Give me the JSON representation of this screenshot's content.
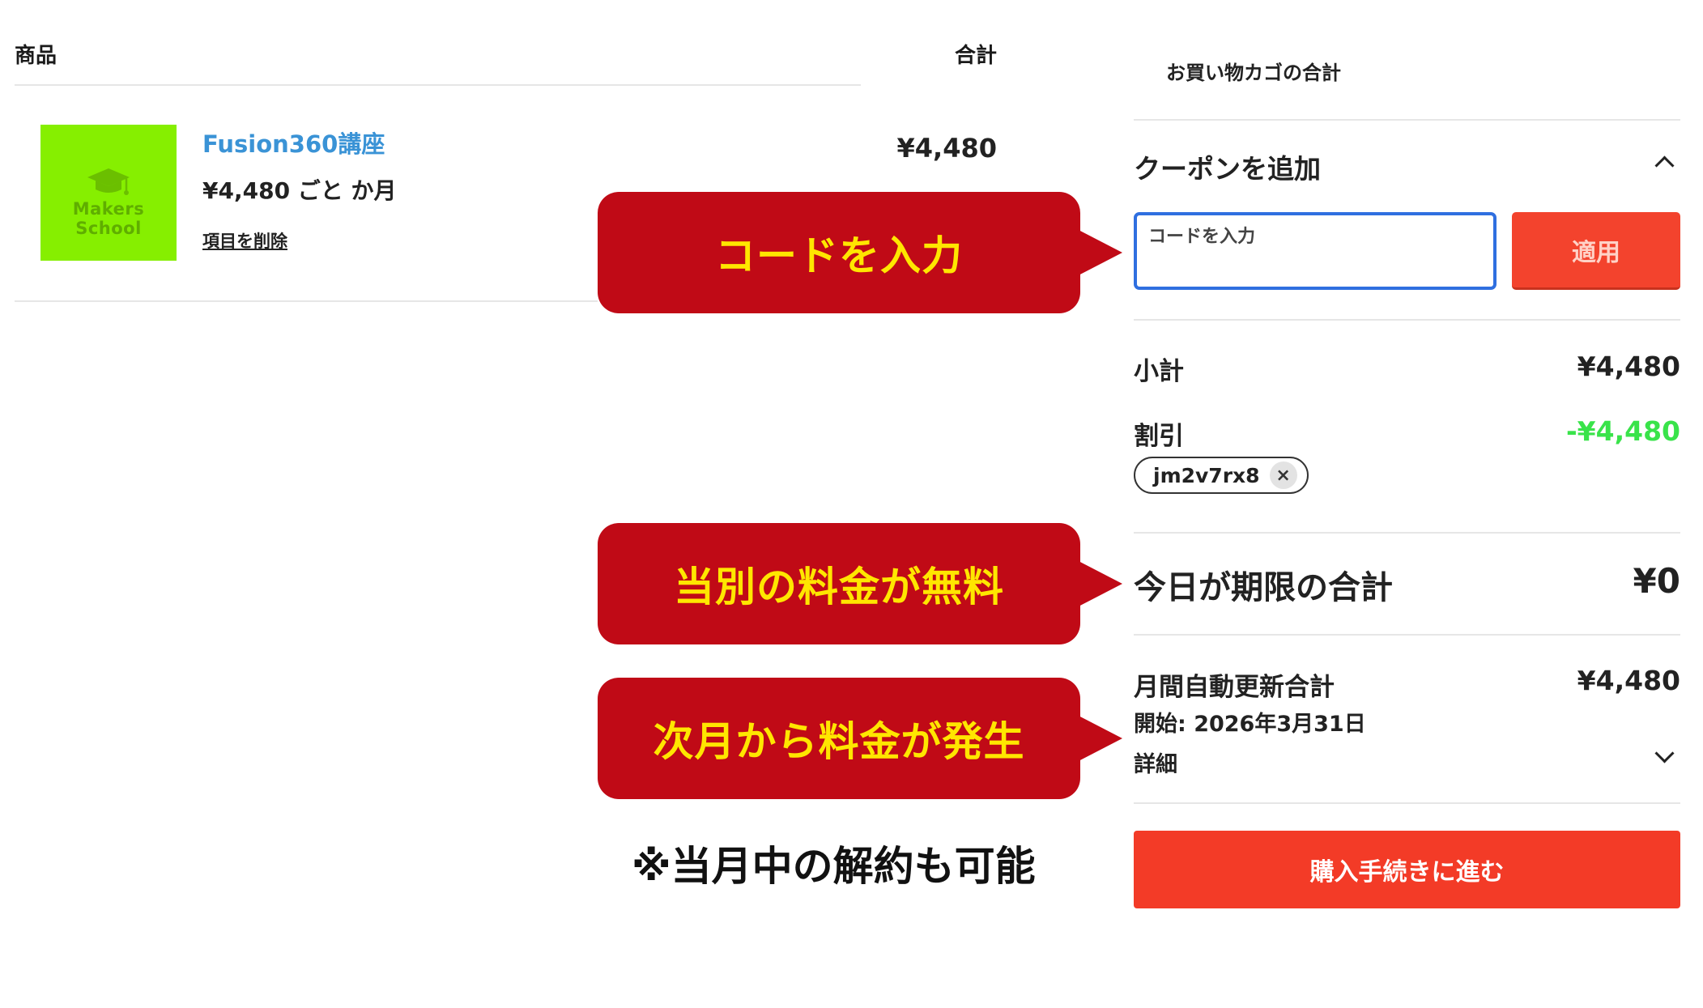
{
  "cart": {
    "columns": {
      "product": "商品",
      "total": "合計"
    },
    "item": {
      "brand": "Makers School",
      "title": "Fusion360講座",
      "price_text": "¥4,480 ごと か月",
      "remove_label": "項目を削除",
      "line_total": "¥4,480"
    }
  },
  "callouts": {
    "code": "コードを入力",
    "free_this_month": "当別の料金が無料",
    "next_month": "次月から料金が発生",
    "note": "※当月中の解約も可能"
  },
  "summary": {
    "title": "お買い物カゴの合計",
    "coupon": {
      "header": "クーポンを追加",
      "placeholder": "コードを入力",
      "apply_label": "適用",
      "applied_code": "jm2v7rx8",
      "remove_symbol": "×"
    },
    "subtotal": {
      "label": "小計",
      "value": "¥4,480"
    },
    "discount": {
      "label": "割引",
      "value": "-¥4,480",
      "color": "#39e34a"
    },
    "due_today": {
      "label": "今日が期限の合計",
      "value": "¥0"
    },
    "monthly": {
      "label": "月間自動更新合計",
      "value": "¥4,480",
      "start": "開始: 2026年3月31日",
      "details_label": "詳細"
    },
    "checkout_label": "購入手続きに進む"
  },
  "colors": {
    "callout_bg": "#c00a16",
    "callout_text": "#ffe600",
    "accent_button": "#f33b27",
    "input_focus": "#2f6fe0",
    "thumb_bg": "#86ef00",
    "link_blue": "#3a93d6"
  },
  "icons": {
    "coupon_toggle": "chevron-up-icon",
    "details_toggle": "chevron-down-icon",
    "chip_remove": "close-icon",
    "thumb": "graduation-cap-icon"
  }
}
